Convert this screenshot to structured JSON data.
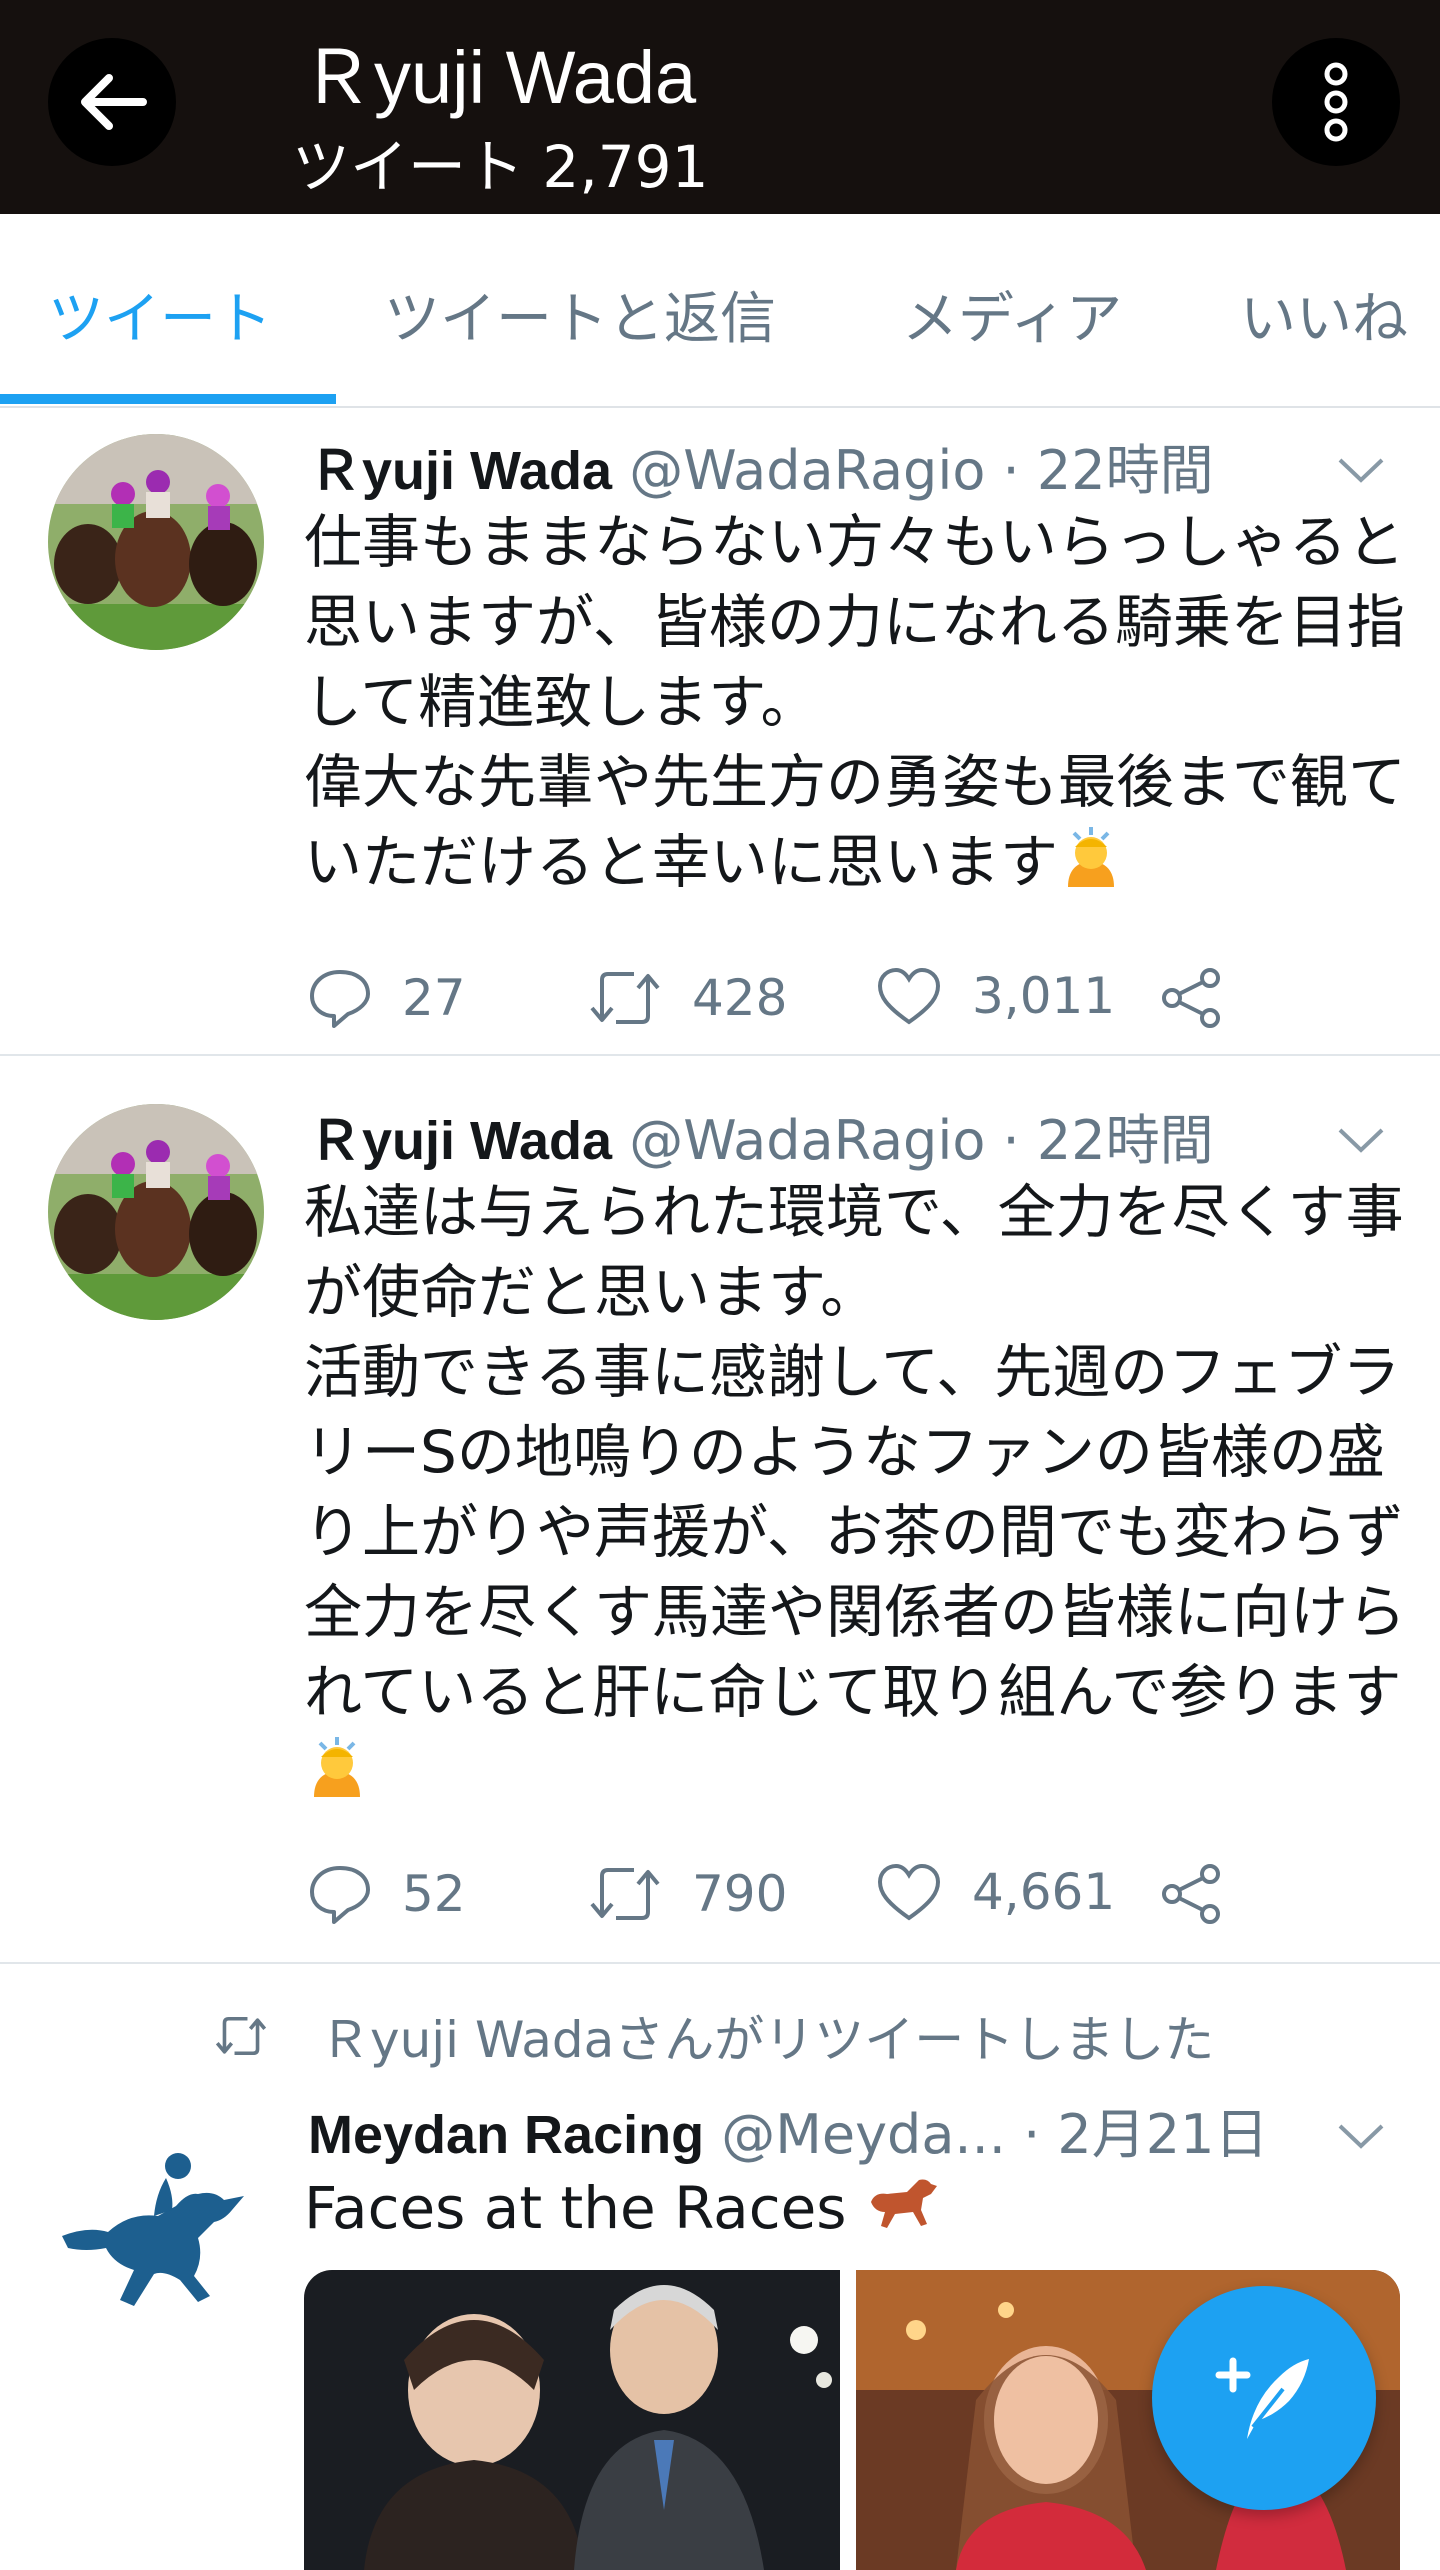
{
  "header": {
    "title": "Ｒyuji Wada",
    "tweet_count": "ツイート 2,791"
  },
  "tabs": [
    {
      "label": "ツイート",
      "active": true
    },
    {
      "label": "ツイートと返信",
      "active": false
    },
    {
      "label": "メディア",
      "active": false
    },
    {
      "label": "いいね",
      "active": false
    }
  ],
  "tweets": [
    {
      "name": "Ｒyuji Wada",
      "handle": "@WadaRagio",
      "time": "· 22時間",
      "text": "仕事もままならない方々もいらっしゃると思いますが、皆様の力になれる騎乗を目指して精進致します。\n偉大な先輩や先生方の勇姿も最後まで観ていただけると幸いに思います",
      "replies": "27",
      "retweets": "428",
      "likes": "3,011"
    },
    {
      "name": "Ｒyuji Wada",
      "handle": "@WadaRagio",
      "time": "· 22時間",
      "text": "私達は与えられた環境で、全力を尽くす事が使命だと思います。\n活動できる事に感謝して、先週のフェブラリーSの地鳴りのようなファンの皆様の盛り上がりや声援が、お茶の間でも変わらず全力を尽くす馬達や関係者の皆様に向けられていると肝に命じて取り組んで参ります",
      "replies": "52",
      "retweets": "790",
      "likes": "4,661"
    },
    {
      "retweeted_by": "Ｒyuji Wadaさんがリツイートしました",
      "name": "Meydan Racing",
      "handle": "@Meyda...",
      "time": "· 2月21日",
      "text": "Faces at the Races"
    }
  ],
  "colors": {
    "header_bg": "#15100e",
    "accent": "#1da1f2",
    "muted": "#657786",
    "meydan_blue": "#1d5f8f"
  }
}
